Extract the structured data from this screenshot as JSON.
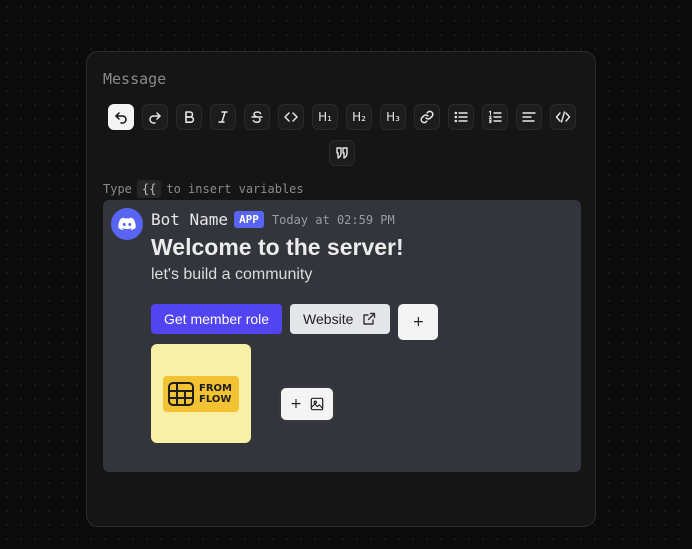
{
  "editor": {
    "label": "Message",
    "hint_prefix": "Type",
    "hint_code": "{{",
    "hint_suffix": "to insert variables",
    "toolbar": [
      {
        "name": "undo-icon",
        "glyph": "",
        "active": true
      },
      {
        "name": "redo-icon",
        "glyph": ""
      },
      {
        "name": "bold-icon",
        "glyph": "B"
      },
      {
        "name": "italic-icon",
        "glyph": "I"
      },
      {
        "name": "strikethrough-icon",
        "glyph": "S"
      },
      {
        "name": "code-icon",
        "glyph": ""
      },
      {
        "name": "heading-1-icon",
        "glyph": "H₁"
      },
      {
        "name": "heading-2-icon",
        "glyph": "H₂"
      },
      {
        "name": "heading-3-icon",
        "glyph": "H₃"
      },
      {
        "name": "link-icon",
        "glyph": ""
      },
      {
        "name": "bullet-list-icon",
        "glyph": ""
      },
      {
        "name": "ordered-list-icon",
        "glyph": ""
      },
      {
        "name": "align-left-icon",
        "glyph": ""
      },
      {
        "name": "code-block-icon",
        "glyph": ""
      },
      {
        "name": "quote-icon",
        "glyph": ""
      }
    ]
  },
  "preview": {
    "avatar_icon": "discord-icon",
    "bot_name": "Bot Name",
    "badge": "APP",
    "timestamp": "Today at 02:59 PM",
    "embed_title": "Welcome to the server!",
    "embed_description": "let's build a community",
    "buttons": {
      "primary": "Get member role",
      "link": "Website",
      "add": "+"
    },
    "thumbnail_text": "FROM FLOW",
    "add_image": "+"
  },
  "colors": {
    "accent": "#5865f2",
    "primary_button": "#5244f0",
    "preview_bg": "#33353c",
    "thumbnail_bg": "#f7f0a6"
  }
}
